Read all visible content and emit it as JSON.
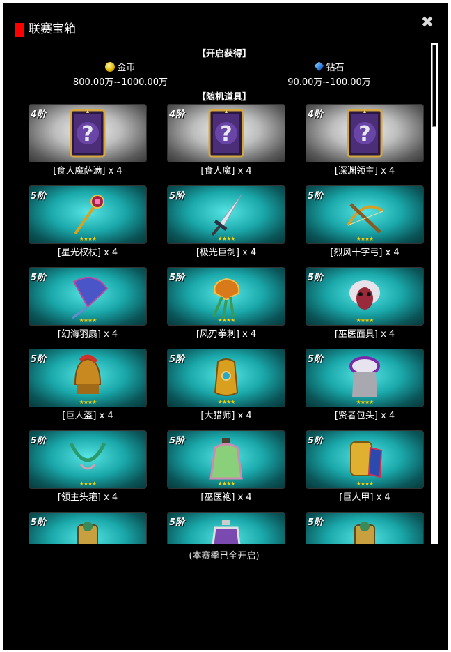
{
  "dialog": {
    "title": "联赛宝箱",
    "close_glyph": "✖"
  },
  "open_reward": {
    "heading": "【开启获得】",
    "currencies": [
      {
        "icon": "gold-coin-icon",
        "name": "金币",
        "range": "800.00万~1000.00万"
      },
      {
        "icon": "diamond-icon",
        "name": "钻石",
        "range": "90.00万~100.00万"
      }
    ]
  },
  "random_items": {
    "heading": "【随机道具】",
    "items": [
      {
        "tier": "4阶",
        "name": "[食人魔萨满] x 4",
        "style": "grey",
        "icon": "mystery-card-icon",
        "stars": ""
      },
      {
        "tier": "4阶",
        "name": "[食人魔] x 4",
        "style": "grey",
        "icon": "mystery-card-icon",
        "stars": ""
      },
      {
        "tier": "4阶",
        "name": "[深渊领主] x 4",
        "style": "grey",
        "icon": "mystery-card-icon",
        "stars": ""
      },
      {
        "tier": "5阶",
        "name": "[星光权杖] x 4",
        "style": "cyan",
        "icon": "starlight-scepter-icon",
        "stars": "★★★★"
      },
      {
        "tier": "5阶",
        "name": "[极光巨剑] x 4",
        "style": "cyan",
        "icon": "aurora-greatsword-icon",
        "stars": "★★★★"
      },
      {
        "tier": "5阶",
        "name": "[烈风十字弓] x 4",
        "style": "cyan",
        "icon": "gale-crossbow-icon",
        "stars": "★★★★"
      },
      {
        "tier": "5阶",
        "name": "[幻海羽扇] x 4",
        "style": "cyan",
        "icon": "feather-fan-icon",
        "stars": "★★★★"
      },
      {
        "tier": "5阶",
        "name": "[风刃拳刺] x 4",
        "style": "cyan",
        "icon": "wind-blade-claw-icon",
        "stars": "★★★★"
      },
      {
        "tier": "5阶",
        "name": "[巫医面具] x 4",
        "style": "cyan",
        "icon": "witch-doctor-mask-icon",
        "stars": "★★★★"
      },
      {
        "tier": "5阶",
        "name": "[巨人盔] x 4",
        "style": "cyan",
        "icon": "giant-helmet-icon",
        "stars": "★★★★"
      },
      {
        "tier": "5阶",
        "name": "[大猎师] x 4",
        "style": "cyan",
        "icon": "hunter-bracer-icon",
        "stars": "★★★★"
      },
      {
        "tier": "5阶",
        "name": "[贤者包头] x 4",
        "style": "cyan",
        "icon": "sage-turban-icon",
        "stars": "★★★★"
      },
      {
        "tier": "5阶",
        "name": "[领主头箍] x 4",
        "style": "cyan",
        "icon": "lord-circlet-icon",
        "stars": "★★★★"
      },
      {
        "tier": "5阶",
        "name": "[巫医袍] x 4",
        "style": "cyan",
        "icon": "witch-doctor-robe-icon",
        "stars": "★★★★"
      },
      {
        "tier": "5阶",
        "name": "[巨人甲] x 4",
        "style": "cyan",
        "icon": "giant-armor-icon",
        "stars": "★★★★"
      },
      {
        "tier": "5阶",
        "name": "",
        "style": "cyan",
        "icon": "armor-item-icon",
        "stars": ""
      },
      {
        "tier": "5阶",
        "name": "",
        "style": "cyan",
        "icon": "robe-item-icon",
        "stars": ""
      },
      {
        "tier": "5阶",
        "name": "",
        "style": "cyan",
        "icon": "armor-item-icon",
        "stars": ""
      }
    ]
  },
  "footer": {
    "status": "(本赛季已全开启)"
  },
  "colors": {
    "accent_red": "#ff0000",
    "star_gold": "#ffd200"
  }
}
